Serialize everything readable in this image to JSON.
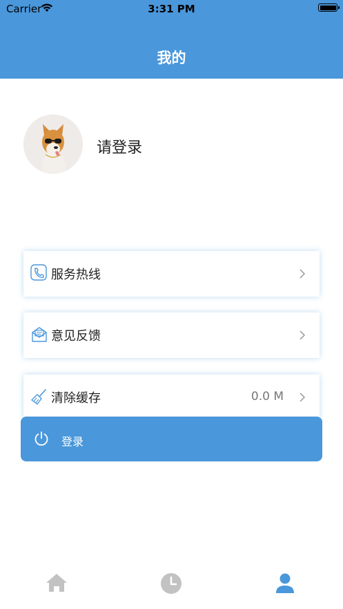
{
  "status_bar": {
    "carrier": "Carrier",
    "time": "3:31 PM"
  },
  "header": {
    "title": "我的"
  },
  "profile": {
    "login_prompt": "请登录"
  },
  "menu": [
    {
      "label": "服务热线",
      "icon": "phone-icon"
    },
    {
      "label": "意见反馈",
      "icon": "feedback-mail-icon"
    },
    {
      "label": "清除缓存",
      "icon": "broom-icon",
      "value": "0.0 M"
    }
  ],
  "login_button": {
    "label": "登录",
    "icon": "power-icon"
  },
  "tabbar": [
    {
      "icon": "home-icon",
      "active": false
    },
    {
      "icon": "clock-icon",
      "active": false
    },
    {
      "icon": "user-icon",
      "active": true
    }
  ],
  "colors": {
    "accent": "#4a97db",
    "tab_inactive": "#c2c2c2"
  }
}
